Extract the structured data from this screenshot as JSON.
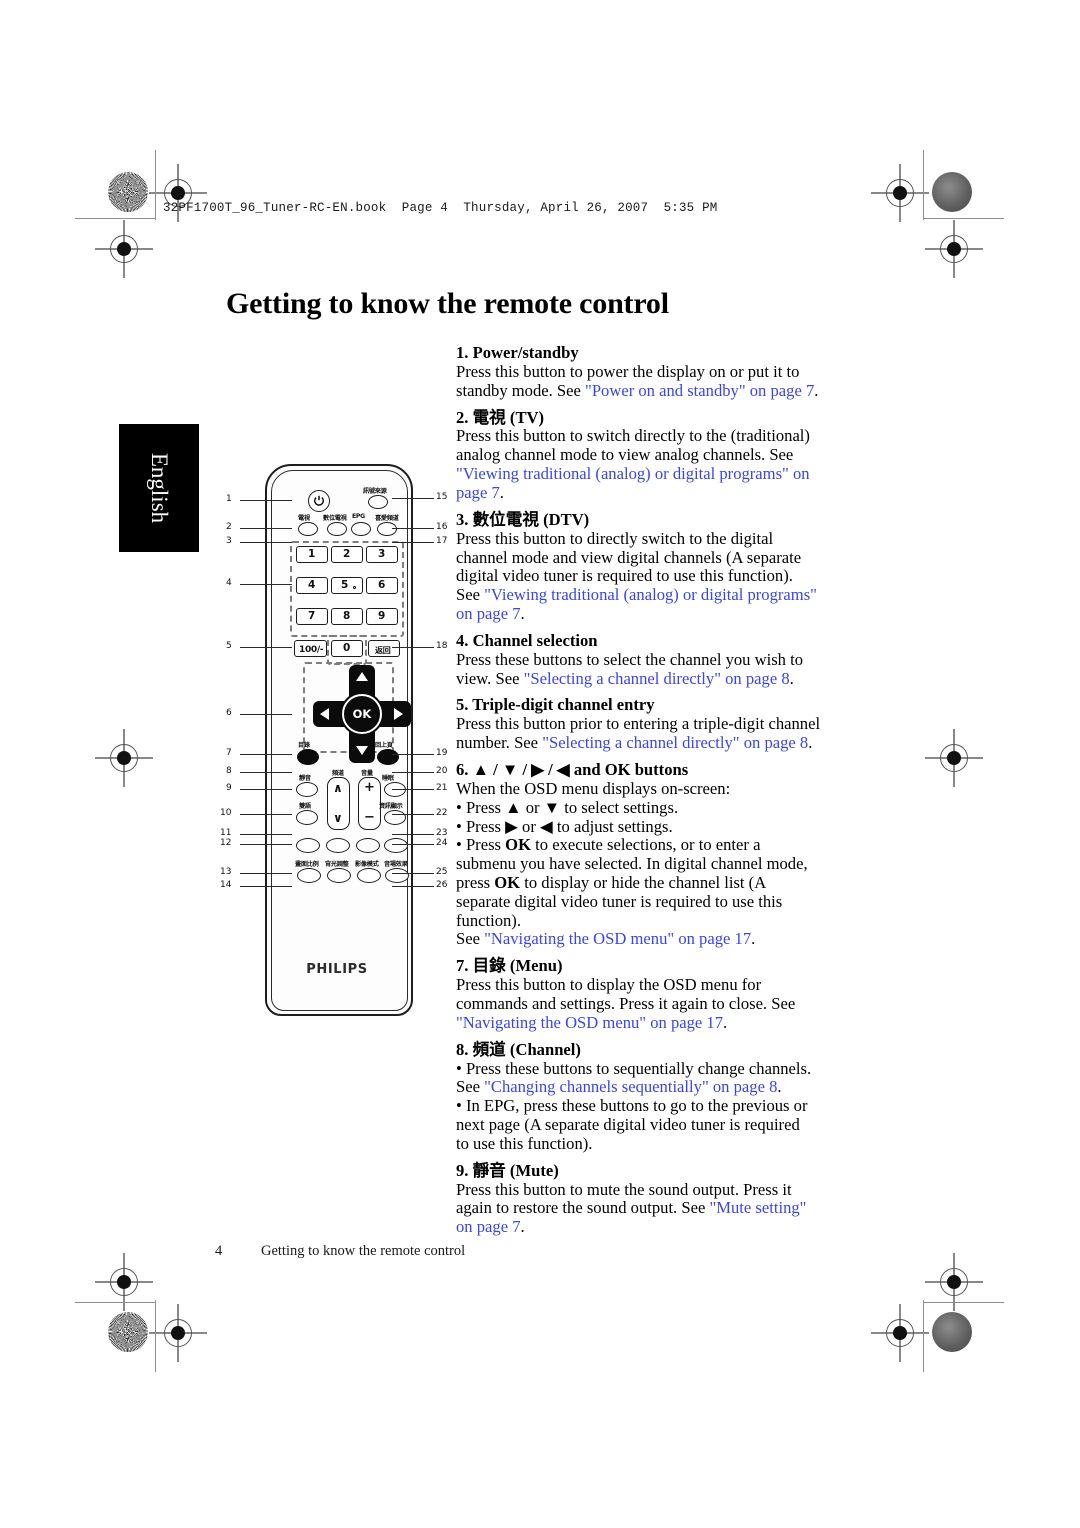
{
  "printer_header": "32PF1700T_96_Tuner-RC-EN.book  Page 4  Thursday, April 26, 2007  5:35 PM",
  "page_title": "Getting to know the remote control",
  "language_tab": "English",
  "footer": {
    "page_number": "4",
    "title": "Getting to know the remote control"
  },
  "link_color": "#3a45e8",
  "sections": [
    {
      "heading": "1. Power/standby",
      "lines": [
        [
          {
            "t": "Press this button to power the display on or put it to",
            "k": "plain"
          }
        ],
        [
          {
            "t": "standby mode. See ",
            "k": "plain"
          },
          {
            "t": "\"Power on and standby\" on page 7",
            "k": "link"
          },
          {
            "t": ".",
            "k": "plain"
          }
        ]
      ]
    },
    {
      "heading": "2. 電視 (TV)",
      "lines": [
        [
          {
            "t": "Press this button to switch directly to the (traditional)",
            "k": "plain"
          }
        ],
        [
          {
            "t": "analog channel mode to view analog channels. See",
            "k": "plain"
          }
        ],
        [
          {
            "t": "\"Viewing traditional (analog) or digital programs\" on",
            "k": "link"
          }
        ],
        [
          {
            "t": "page 7",
            "k": "link"
          },
          {
            "t": ".",
            "k": "plain"
          }
        ]
      ]
    },
    {
      "heading": "3. 數位電視 (DTV)",
      "lines": [
        [
          {
            "t": "Press this button to directly switch to the digital",
            "k": "plain"
          }
        ],
        [
          {
            "t": "channel mode and view digital channels (A separate",
            "k": "plain"
          }
        ],
        [
          {
            "t": "digital video tuner is required to use this function).",
            "k": "plain"
          }
        ],
        [
          {
            "t": "See ",
            "k": "plain"
          },
          {
            "t": "\"Viewing traditional (analog) or digital programs\"",
            "k": "link"
          }
        ],
        [
          {
            "t": "on page 7",
            "k": "link"
          },
          {
            "t": ".",
            "k": "plain"
          }
        ]
      ]
    },
    {
      "heading": "4. Channel selection",
      "lines": [
        [
          {
            "t": "Press these buttons to select the channel you wish to",
            "k": "plain"
          }
        ],
        [
          {
            "t": "view. See ",
            "k": "plain"
          },
          {
            "t": "\"Selecting a channel directly\" on page 8",
            "k": "link"
          },
          {
            "t": ".",
            "k": "plain"
          }
        ]
      ]
    },
    {
      "heading": "5. Triple-digit channel entry",
      "lines": [
        [
          {
            "t": "Press this button prior to entering a triple-digit channel",
            "k": "plain"
          }
        ],
        [
          {
            "t": "number. See ",
            "k": "plain"
          },
          {
            "t": "\"Selecting a channel directly\" on page 8",
            "k": "link"
          },
          {
            "t": ".",
            "k": "plain"
          }
        ]
      ]
    },
    {
      "heading": "6. ▲ / ▼ / ▶ / ◀ and OK buttons",
      "lines": [
        [
          {
            "t": "When the OSD menu displays on-screen:",
            "k": "plain"
          }
        ],
        [
          {
            "t": "• Press ▲ or ▼ to select settings.",
            "k": "plain"
          }
        ],
        [
          {
            "t": "• Press ▶ or ◀ to adjust settings.",
            "k": "plain"
          }
        ],
        [
          {
            "t": "• Press ",
            "k": "plain"
          },
          {
            "t": "OK",
            "k": "bold"
          },
          {
            "t": " to execute selections, or to enter a",
            "k": "plain"
          }
        ],
        [
          {
            "t": "   submenu you have selected. In digital channel mode,",
            "k": "plain"
          }
        ],
        [
          {
            "t": "   press ",
            "k": "plain"
          },
          {
            "t": "OK",
            "k": "bold"
          },
          {
            "t": " to display or hide the channel list (A",
            "k": "plain"
          }
        ],
        [
          {
            "t": "   separate digital video tuner is required to use this",
            "k": "plain"
          }
        ],
        [
          {
            "t": "   function).",
            "k": "plain"
          }
        ],
        [
          {
            "t": "See ",
            "k": "plain"
          },
          {
            "t": "\"Navigating the OSD menu\" on page 17",
            "k": "link"
          },
          {
            "t": ".",
            "k": "plain"
          }
        ]
      ]
    },
    {
      "heading": "7. 目錄 (Menu)",
      "lines": [
        [
          {
            "t": "Press this button to display the OSD menu for",
            "k": "plain"
          }
        ],
        [
          {
            "t": "commands and settings. Press it again to close. See",
            "k": "plain"
          }
        ],
        [
          {
            "t": "\"Navigating the OSD menu\" on page 17",
            "k": "link"
          },
          {
            "t": ".",
            "k": "plain"
          }
        ]
      ]
    },
    {
      "heading": "8. 頻道 (Channel)",
      "lines": [
        [
          {
            "t": "• Press these buttons to sequentially change channels.",
            "k": "plain"
          }
        ],
        [
          {
            "t": "   See ",
            "k": "plain"
          },
          {
            "t": "\"Changing channels sequentially\" on page 8",
            "k": "link"
          },
          {
            "t": ".",
            "k": "plain"
          }
        ],
        [
          {
            "t": "• In EPG, press these buttons to go to the previous or",
            "k": "plain"
          }
        ],
        [
          {
            "t": "   next page (A separate digital video tuner is required",
            "k": "plain"
          }
        ],
        [
          {
            "t": "   to use this function).",
            "k": "plain"
          }
        ]
      ]
    },
    {
      "heading": "9. 靜音 (Mute)",
      "lines": [
        [
          {
            "t": "Press this button to mute the sound output. Press it",
            "k": "plain"
          }
        ],
        [
          {
            "t": "again to restore the sound output. See ",
            "k": "plain"
          },
          {
            "t": "\"Mute setting\"",
            "k": "link"
          }
        ],
        [
          {
            "t": "on page 7",
            "k": "link"
          },
          {
            "t": ".",
            "k": "plain"
          }
        ]
      ]
    }
  ],
  "remote": {
    "brand": "PHILIPS",
    "buttons": {
      "power": "⏻",
      "source": "訊號來源",
      "tv": "電視",
      "dtv": "數位電視",
      "epg": "EPG",
      "favorite": "喜愛頻道",
      "digit_1": "1",
      "digit_2": "2",
      "digit_3": "3",
      "digit_4": "4",
      "digit_5": "5",
      "digit_6": "6",
      "digit_7": "7",
      "digit_8": "8",
      "digit_9": "9",
      "digit_0": "0",
      "hundred": "100/-",
      "return": "返回",
      "ok": "OK",
      "menu": "目錄",
      "back": "回上頁",
      "mute": "靜音",
      "bilingual": "雙語",
      "channel": "頻道",
      "volume": "音量",
      "sleep": "睡眠",
      "info": "資訊顯示",
      "aspect": "畫面比例",
      "backlight": "背光調整",
      "picture_mode": "影像模式",
      "sound_effect": "音場效果",
      "vol_up": "+",
      "vol_down": "−",
      "ch_up": "∧",
      "ch_down": "∨"
    },
    "callouts_left": [
      "1",
      "2",
      "3",
      "4",
      "5",
      "6",
      "7",
      "8",
      "9",
      "10",
      "11",
      "12",
      "13",
      "14"
    ],
    "callouts_right": [
      "15",
      "16",
      "17",
      "18",
      "19",
      "20",
      "21",
      "22",
      "23",
      "24",
      "25",
      "26"
    ]
  }
}
